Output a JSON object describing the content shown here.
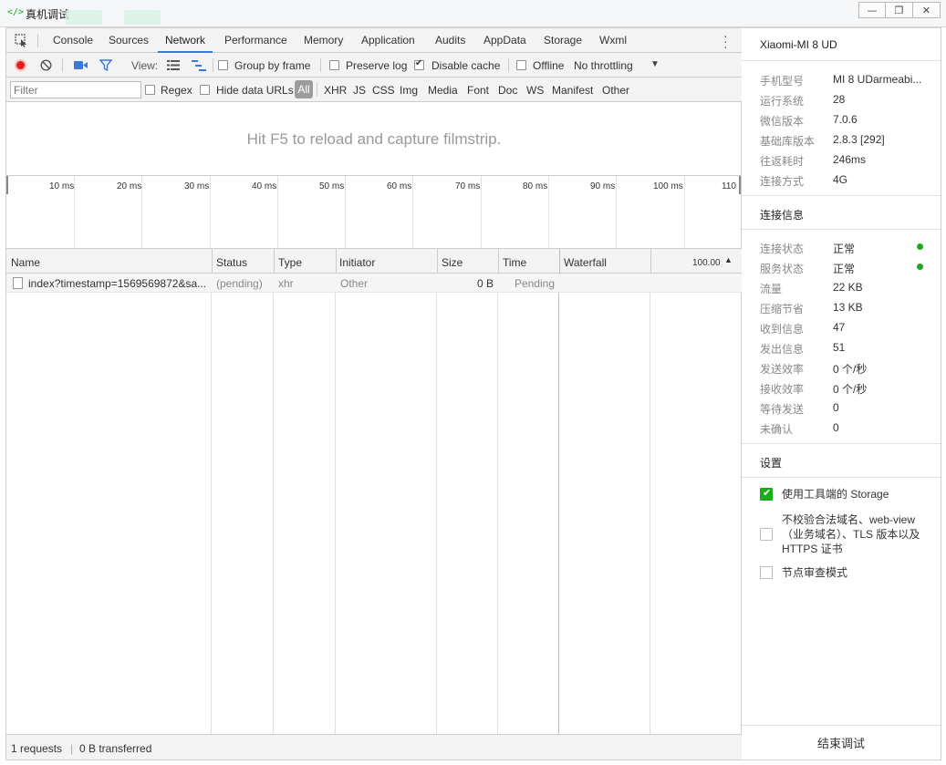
{
  "window": {
    "title": "真机调试",
    "min": "—",
    "restore": "❐",
    "close": "✕"
  },
  "tabs": [
    "Console",
    "Sources",
    "Network",
    "Performance",
    "Memory",
    "Application",
    "Audits",
    "AppData",
    "Storage",
    "Wxml"
  ],
  "active_tab": "Network",
  "toolbar": {
    "view_label": "View:",
    "group_by_frame": "Group by frame",
    "preserve_log": "Preserve log",
    "disable_cache": "Disable cache",
    "offline": "Offline",
    "throttling": "No throttling"
  },
  "filterbar": {
    "placeholder": "Filter",
    "regex": "Regex",
    "hide_data_urls": "Hide data URLs",
    "all": "All",
    "types": [
      "XHR",
      "JS",
      "CSS",
      "Img",
      "Media",
      "Font",
      "Doc",
      "WS",
      "Manifest",
      "Other"
    ]
  },
  "filmstrip_hint": "Hit F5 to reload and capture filmstrip.",
  "overview_ticks": [
    "10 ms",
    "20 ms",
    "30 ms",
    "40 ms",
    "50 ms",
    "60 ms",
    "70 ms",
    "80 ms",
    "90 ms",
    "100 ms",
    "110"
  ],
  "columns": {
    "name": "Name",
    "status": "Status",
    "type": "Type",
    "initiator": "Initiator",
    "size": "Size",
    "time": "Time",
    "waterfall": "Waterfall",
    "waterfall_value": "100.00"
  },
  "requests": [
    {
      "name": "index?timestamp=1569569872&sa...",
      "status": "(pending)",
      "type": "xhr",
      "initiator": "Other",
      "size": "0 B",
      "time": "Pending"
    }
  ],
  "statusbar": {
    "requests": "1 requests",
    "sep": "|",
    "transferred": "0 B transferred"
  },
  "side": {
    "device_name": "Xiaomi-MI 8 UD",
    "device_info": [
      {
        "k": "手机型号",
        "v": "MI 8 UDarmeabi..."
      },
      {
        "k": "运行系统",
        "v": "28"
      },
      {
        "k": "微信版本",
        "v": "7.0.6"
      },
      {
        "k": "基础库版本",
        "v": "2.8.3 [292]"
      },
      {
        "k": "往返耗时",
        "v": "246ms"
      },
      {
        "k": "连接方式",
        "v": "4G"
      }
    ],
    "conn_title": "连接信息",
    "conn_info": [
      {
        "k": "连接状态",
        "v": "正常"
      },
      {
        "k": "服务状态",
        "v": "正常"
      },
      {
        "k": "流量",
        "v": "22 KB"
      },
      {
        "k": "压缩节省",
        "v": "13 KB"
      },
      {
        "k": "收到信息",
        "v": "47"
      },
      {
        "k": "发出信息",
        "v": "51"
      },
      {
        "k": "发送效率",
        "v": "0 个/秒"
      },
      {
        "k": "接收效率",
        "v": "0 个/秒"
      },
      {
        "k": "等待发送",
        "v": "0"
      },
      {
        "k": "未确认",
        "v": "0"
      }
    ],
    "settings_title": "设置",
    "settings": [
      {
        "label": "使用工具端的 Storage",
        "checked": true
      },
      {
        "label": "不校验合法域名、web-view（业务域名）、TLS 版本以及 HTTPS 证书",
        "checked": false
      },
      {
        "label": "节点审查模式",
        "checked": false
      }
    ],
    "end_button": "结束调试"
  },
  "colors": {
    "accent": "#1aad19",
    "tab_underline": "#3879d9",
    "record": "#e0201d",
    "filter_icon": "#3879d9"
  }
}
